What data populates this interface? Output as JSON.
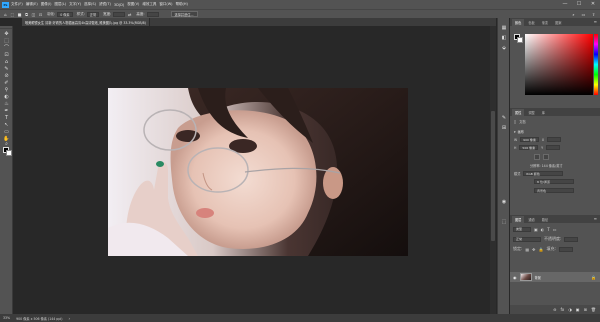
{
  "menubar": {
    "logo": "Ps",
    "items": [
      "文件(F)",
      "编辑(E)",
      "图像(I)",
      "图层(L)",
      "文字(Y)",
      "选择(S)",
      "滤镜(T)",
      "3D(D)",
      "视图(V)",
      "增效工具",
      "窗口(W)",
      "帮助(H)"
    ],
    "minimize": "—",
    "maximize": "☐",
    "close": "✕"
  },
  "options": {
    "feather_label": "羽化:",
    "feather_value": "0 像素",
    "style_label": "样式:",
    "style_value": "正常",
    "width_label": "宽度:",
    "height_label": "高度:",
    "select_mask_button": "选择并遮住..."
  },
  "document_tab": {
    "title": "唯美眼镜女生 清新 好看的人物插画高清4k高清壁纸_唯美图片.jpg @ 33.3%(RGB/8)",
    "close": "×"
  },
  "tools": [
    "✥",
    "⬚",
    "⌒",
    "⊡",
    "⌂",
    "✎",
    "⊘",
    "✐",
    "⚲",
    "◐",
    "♨",
    "✒",
    "T",
    "↖",
    "▭",
    "✋",
    "⌕"
  ],
  "strip_icons": [
    "▦",
    "◧",
    "⬙",
    "✎",
    "⊞",
    "◉",
    "⬚"
  ],
  "color_panel": {
    "tabs": [
      "颜色",
      "色板",
      "渐变",
      "图案"
    ]
  },
  "properties_panel": {
    "tabs": [
      "属性",
      "调整",
      "库"
    ],
    "doc_label": "文档",
    "canvas_section": "画布",
    "width_label": "W",
    "width_value": "900 像素",
    "height_label": "H",
    "height_value": "506 像素",
    "x_label": "X",
    "y_label": "Y",
    "resolution": "分辨率: 144 像素/英寸",
    "mode_label": "模式",
    "mode_value": "RGB 颜色",
    "depth_value": "8 位/通道",
    "fill_value": "背景色"
  },
  "layers_panel": {
    "tabs": [
      "图层",
      "通道",
      "路径"
    ],
    "kind_value": "类型",
    "blend_value": "正常",
    "opacity_label": "不透明度:",
    "lock_label": "锁定:",
    "fill_label": "填充:",
    "layer_name": "背景",
    "bottom_icons": [
      "⊖",
      "fx",
      "◑",
      "▣",
      "⊞",
      "🗑"
    ]
  },
  "status": {
    "zoom": "33%",
    "doc_size": "900 像素 x 506 像素 (144 ppi)",
    "arrow": "›"
  }
}
